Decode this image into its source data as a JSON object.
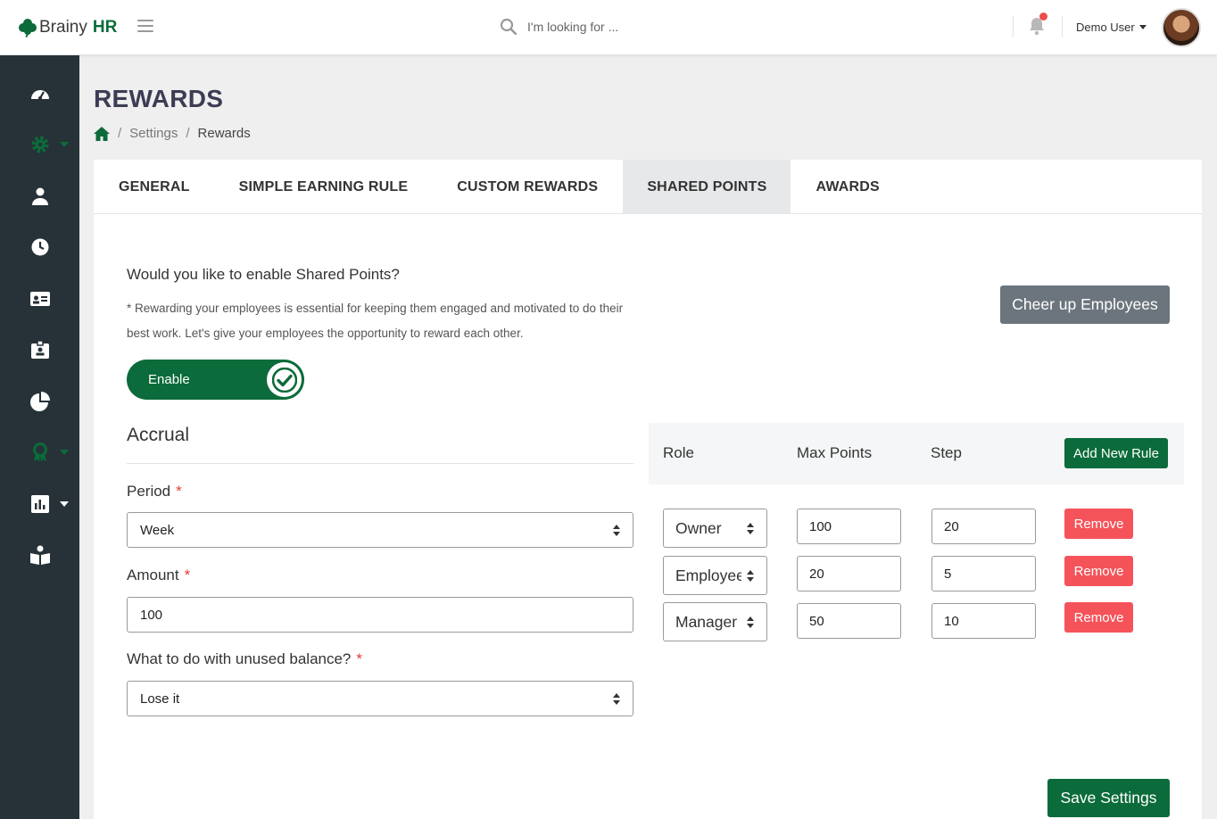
{
  "brand": {
    "name": "Brainy",
    "name_bold": "HR",
    "accent": "#0b6b3a"
  },
  "header": {
    "search_placeholder": "I'm looking for ...",
    "user_name": "Demo User"
  },
  "sidebar": {
    "items": [
      {
        "icon": "dashboard-icon"
      },
      {
        "icon": "settings-icon",
        "dropdown": true,
        "active": true
      },
      {
        "icon": "employee-icon"
      },
      {
        "icon": "clock-icon"
      },
      {
        "icon": "id-card-icon"
      },
      {
        "icon": "badge-icon"
      },
      {
        "icon": "pie-chart-icon"
      },
      {
        "icon": "award-icon",
        "dropdown": true,
        "active": true
      },
      {
        "icon": "report-icon",
        "dropdown": true
      },
      {
        "icon": "training-icon"
      }
    ]
  },
  "page": {
    "title": "REWARDS",
    "breadcrumb": [
      "Settings",
      "Rewards"
    ]
  },
  "tabs": [
    {
      "label": "GENERAL",
      "active": false
    },
    {
      "label": "SIMPLE EARNING RULE",
      "active": false
    },
    {
      "label": "CUSTOM REWARDS",
      "active": false
    },
    {
      "label": "SHARED POINTS",
      "active": true
    },
    {
      "label": "AWARDS",
      "active": false
    }
  ],
  "shared": {
    "question": "Would you like to enable Shared Points?",
    "note": "* Rewarding your employees is essential for keeping them engaged and motivated to do their best work. Let's give your employees the opportunity to reward each other.",
    "toggle_label": "Enable",
    "cheer_button": "Cheer up Employees"
  },
  "accrual": {
    "title": "Accrual",
    "period_label": "Period",
    "period_value": "Week",
    "amount_label": "Amount",
    "amount_value": "100",
    "unused_label": "What to do with unused balance?",
    "unused_value": "Lose it",
    "required_mark": "*"
  },
  "rules": {
    "headers": {
      "role": "Role",
      "max_points": "Max Points",
      "step": "Step"
    },
    "add_button": "Add New Rule",
    "remove_label": "Remove",
    "rows": [
      {
        "role": "Owner",
        "max_points": "100",
        "step": "20"
      },
      {
        "role": "Employee",
        "max_points": "20",
        "step": "5"
      },
      {
        "role": "Manager",
        "max_points": "50",
        "step": "10"
      }
    ]
  },
  "save_button": "Save Settings"
}
